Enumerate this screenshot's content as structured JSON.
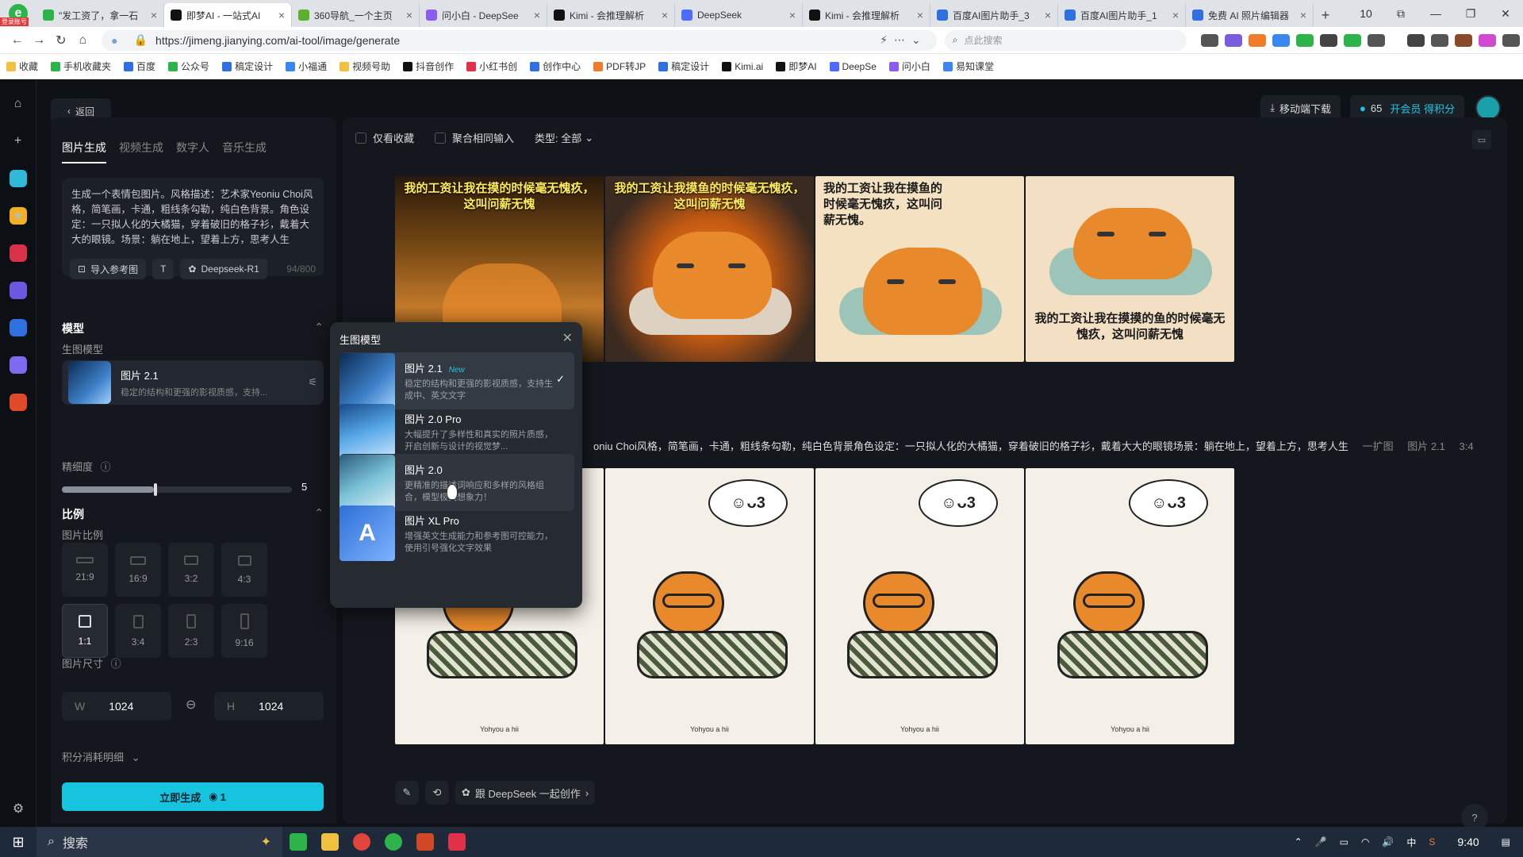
{
  "browser": {
    "badge": "登录账号",
    "tabs": [
      {
        "title": "\"发工资了，拿一石",
        "color": "#2cb34a"
      },
      {
        "title": "即梦AI - 一站式AI",
        "color": "#111"
      },
      {
        "title": "360导航_一个主页",
        "color": "#5bb12e"
      },
      {
        "title": "问小白 - DeepSee",
        "color": "#8a5cf0"
      },
      {
        "title": "Kimi - 会推理解析",
        "color": "#111"
      },
      {
        "title": "DeepSeek",
        "color": "#4d6bfe"
      },
      {
        "title": "Kimi - 会推理解析",
        "color": "#111"
      },
      {
        "title": "百度AI图片助手_3",
        "color": "#2f6fe0"
      },
      {
        "title": "百度AI图片助手_1",
        "color": "#2f6fe0"
      },
      {
        "title": "免费 AI 照片编辑器",
        "color": "#2f6fe0"
      }
    ],
    "tab_count": "10",
    "url": "https://jimeng.jianying.com/ai-tool/image/generate",
    "search_placeholder": "点此搜索",
    "bookmarks": [
      "收藏",
      "手机收藏夹",
      "百度",
      "公众号",
      "稿定设计",
      "小福通",
      "视频号助",
      "抖音创作",
      "小红书创",
      "创作中心",
      "PDF转JP",
      "稿定设计",
      "Kimi.ai",
      "即梦AI",
      "DeepSe",
      "问小白",
      "易知课堂"
    ]
  },
  "header": {
    "back": "返回",
    "download": "移动端下载",
    "credits": "65",
    "vip": "开会员 得积分"
  },
  "side": {
    "tabs": [
      "图片生成",
      "视频生成",
      "数字人",
      "音乐生成"
    ],
    "prompt": "生成一个表情包图片。风格描述：艺术家Yeoniu Choi风格，简笔画，卡通，粗线条勾勒，纯白色背景。角色设定：一只拟人化的大橘猫，穿着破旧的格子衫，戴着大大的眼镜。场景：躺在地上，望着上方，思考人生",
    "ref_button": "导入参考图",
    "deepseek_chip": "Deepseek-R1",
    "char_count": "94/800",
    "model_section": "模型",
    "model_label": "生图模型",
    "model_name": "图片 2.1",
    "model_desc": "稳定的结构和更强的影视质感，支持...",
    "detail_label": "精细度",
    "detail_value": "5",
    "detail_fraction": 0.5,
    "ratio_section": "比例",
    "ratio_label": "图片比例",
    "ratios": [
      "21:9",
      "16:9",
      "3:2",
      "4:3",
      "1:1",
      "3:4",
      "2:3",
      "9:16"
    ],
    "ratio_selected": "1:1",
    "size_label": "图片尺寸",
    "width_key": "W",
    "width": "1024",
    "height_key": "H",
    "height": "1024",
    "credits_detail": "积分消耗明细",
    "generate": "立即生成",
    "generate_cost": "1"
  },
  "main": {
    "filter_fav": "仅看收藏",
    "filter_merge": "聚合相同输入",
    "filter_type": "类型: 全部",
    "captions": [
      "我的工资让我在摸的时候毫无愧疚，这叫问薪无愧",
      "我的工资让我摸鱼的时候毫无愧疚，这叫问薪无愧",
      "我的工资让我在摸鱼的时候毫无愧疚，这叫问薪无愧。",
      "我的工资让我在摸摸的鱼的时候毫无愧疚，这叫问薪无愧"
    ],
    "prompt_info": "oniu Choi风格，简笔画，卡通，粗线条勾勒，纯白色背景角色设定：一只拟人化的大橘猫，穿着破旧的格子衫，戴着大大的眼镜场景：躺在地上，望着上方，思考人生",
    "info_expand": "一扩图",
    "info_model": "图片 2.1",
    "info_ratio": "3:4",
    "bubble": "☺ᴗ3",
    "signature": "Yohyou a hii",
    "deepseek_button": "跟 DeepSeek 一起创作"
  },
  "popup": {
    "title": "生图模型",
    "options": [
      {
        "name": "图片 2.1",
        "badge": "New",
        "desc": "稳定的结构和更强的影视质感，支持生成中、英文文字"
      },
      {
        "name": "图片 2.0 Pro",
        "badge": "",
        "desc": "大幅提升了多样性和真实的照片质感，开启创新与设计的视觉梦..."
      },
      {
        "name": "图片 2.0",
        "badge": "",
        "desc": "更精准的描述词响应和多样的风格组合，模型极具想象力！"
      },
      {
        "name": "图片 XL Pro",
        "badge": "",
        "desc": "增强英文生成能力和参考图可控能力，使用引号强化文字效果"
      }
    ]
  },
  "taskbar": {
    "search": "搜索",
    "time": "9:40",
    "ime": "中"
  }
}
